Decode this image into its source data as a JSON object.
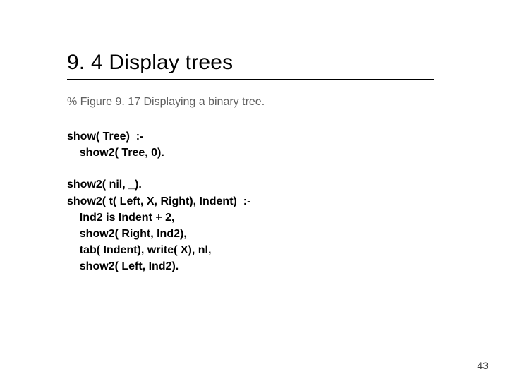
{
  "title": "9. 4 Display trees",
  "comment": "% Figure 9. 17  Displaying a binary tree.",
  "code1": "show( Tree)  :-\n    show2( Tree, 0).",
  "code2": "show2( nil, _).\nshow2( t( Left, X, Right), Indent)  :-\n    Ind2 is Indent + 2,\n    show2( Right, Ind2),\n    tab( Indent), write( X), nl,\n    show2( Left, Ind2).",
  "page_number": "43"
}
